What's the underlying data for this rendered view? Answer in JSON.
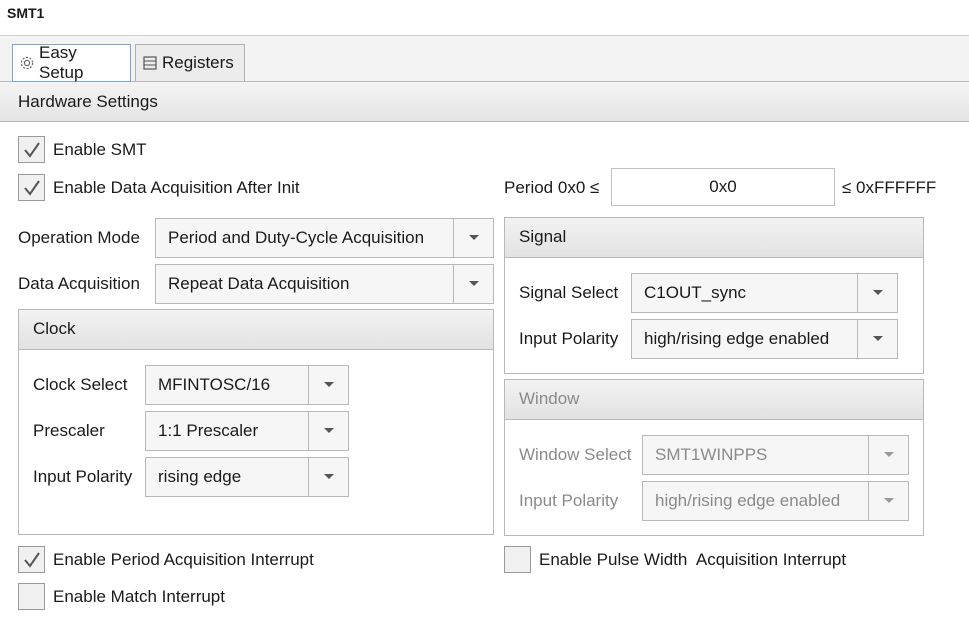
{
  "title": "SMT1",
  "tabs": [
    {
      "label": "Easy Setup",
      "icon": "gear-icon",
      "active": true
    },
    {
      "label": "Registers",
      "icon": "list-icon",
      "active": false
    }
  ],
  "hardware_settings": {
    "header": "Hardware Settings",
    "enable_smt": {
      "label": "Enable SMT",
      "checked": true
    },
    "enable_data_acq": {
      "label": "Enable Data Acquisition After Init",
      "checked": true
    },
    "period": {
      "prefix": "Period 0x0 ≤",
      "value": "0x0",
      "suffix": "≤  0xFFFFFF"
    },
    "operation_mode": {
      "label": "Operation Mode",
      "value": "Period and Duty-Cycle Acquisition"
    },
    "data_acquisition": {
      "label": "Data Acquisition",
      "value": "Repeat Data Acquisition"
    },
    "clock": {
      "header": "Clock",
      "clock_select": {
        "label": "Clock Select",
        "value": "MFINTOSC/16"
      },
      "prescaler": {
        "label": "Prescaler",
        "value": "1:1 Prescaler"
      },
      "input_polarity": {
        "label": "Input Polarity",
        "value": "rising edge"
      }
    },
    "signal": {
      "header": "Signal",
      "signal_select": {
        "label": "Signal Select",
        "value": "C1OUT_sync"
      },
      "input_polarity": {
        "label": "Input Polarity",
        "value": "high/rising edge enabled"
      }
    },
    "window": {
      "header": "Window",
      "window_select": {
        "label": "Window Select",
        "value": "SMT1WINPPS"
      },
      "input_polarity": {
        "label": "Input Polarity",
        "value": "high/rising edge enabled"
      }
    },
    "period_interrupt": {
      "label": "Enable Period Acquisition Interrupt",
      "checked": true
    },
    "pulse_interrupt": {
      "label": "Enable Pulse Width  Acquisition Interrupt",
      "checked": false
    },
    "match_interrupt": {
      "label": "Enable Match Interrupt",
      "checked": false
    }
  }
}
